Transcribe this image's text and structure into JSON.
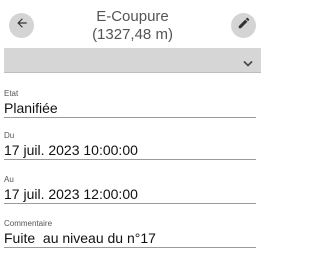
{
  "header": {
    "title": "E-Coupure",
    "subtitle": "(1327,48 m)",
    "back_icon": "arrow-left-icon",
    "edit_icon": "pencil-icon"
  },
  "select": {
    "value": "",
    "icon": "chevron-down-icon"
  },
  "fields": {
    "etat": {
      "label": "Etat",
      "value": "Planifiée"
    },
    "du": {
      "label": "Du",
      "value": "17 juil. 2023 10:00:00"
    },
    "au": {
      "label": "Au",
      "value": "17 juil. 2023 12:00:00"
    },
    "commentaire": {
      "label": "Commentaire",
      "value": "Fuite  au niveau du n°17"
    }
  },
  "colors": {
    "button_bg": "#d4d4d4",
    "select_bg": "#d6d6d6",
    "underline": "#9a9a9a"
  }
}
